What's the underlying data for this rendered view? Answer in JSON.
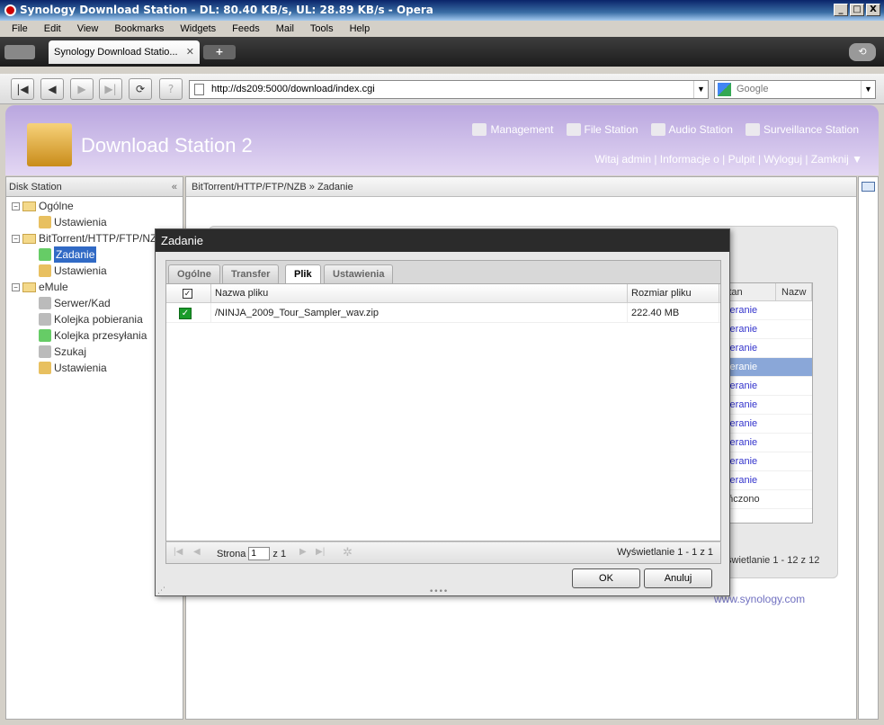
{
  "window": {
    "title": "Synology Download Station - DL: 80.40 KB/s, UL: 28.89 KB/s - Opera",
    "controls": [
      "_",
      "□",
      "X"
    ]
  },
  "menu": [
    "File",
    "Edit",
    "View",
    "Bookmarks",
    "Widgets",
    "Feeds",
    "Mail",
    "Tools",
    "Help"
  ],
  "browser_tab": {
    "label": "Synology Download Statio...",
    "close": "✕",
    "new": "+"
  },
  "nav": {
    "url": "http://ds209:5000/download/index.cgi",
    "search_placeholder": "Google"
  },
  "app": {
    "title": "Download Station 2",
    "links": [
      "Management",
      "File Station",
      "Audio Station",
      "Surveillance Station"
    ],
    "user_links": "Witaj admin | Informacje o | Pulpit | Wyloguj  | Zamknij ▼"
  },
  "sidebar": {
    "header": "Disk Station",
    "collapse": "«",
    "nodes": [
      "Ogólne",
      "Ustawienia",
      "BitTorrent/HTTP/FTP/NZB",
      "Zadanie",
      "Ustawienia",
      "eMule",
      "Serwer/Kad",
      "Kolejka pobierania",
      "Kolejka przesyłania",
      "Szukaj",
      "Ustawienia"
    ]
  },
  "main": {
    "breadcrumb": "BitTorrent/HTTP/FTP/NZB » Zadanie",
    "bg_columns": [
      "Stan",
      "Nazw"
    ],
    "bg_rows": [
      "bieranie",
      "bieranie",
      "bieranie",
      "bieranie",
      "bieranie",
      "bieranie",
      "bieranie",
      "bieranie",
      "bieranie",
      "bieranie",
      "ończono"
    ],
    "bg_status": "świetlanie 1 - 12 z 12",
    "synology_link": "www.synology.com"
  },
  "dialog": {
    "title": "Zadanie",
    "tabs": [
      "Ogólne",
      "Transfer",
      "Plik",
      "Ustawienia"
    ],
    "columns": [
      "Nazwa pliku",
      "Rozmiar pliku"
    ],
    "rows": [
      {
        "name": "/NINJA_2009_Tour_Sampler_wav.zip",
        "size": "222.40 MB",
        "checked": true
      }
    ],
    "pager": {
      "label": "Strona",
      "page": "1",
      "of": "z 1",
      "display": "Wyświetlanie 1 - 1 z 1"
    },
    "ok": "OK",
    "cancel": "Anuluj"
  }
}
